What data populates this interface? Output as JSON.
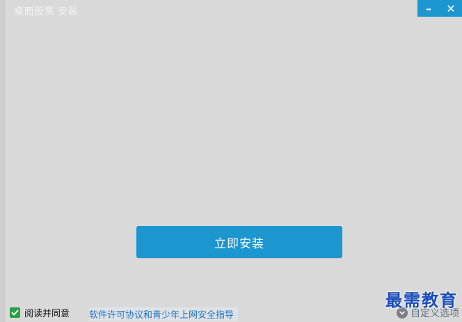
{
  "window": {
    "title": "桌面股票 安装",
    "minimize_glyph": "–",
    "close_glyph": "✕"
  },
  "main": {
    "install_label": "立即安装"
  },
  "footer": {
    "agree_checked": true,
    "agree_label": "阅读并同意",
    "license_link": "软件许可协议和青少年上网安全指导",
    "custom_options_label": "自定义选项"
  },
  "watermark": {
    "text": "最需教育"
  },
  "colors": {
    "background": "#d9d9d9",
    "accent": "#1b96cf",
    "checkbox": "#2aa043",
    "link": "#1e73be",
    "watermark": "#1a4bb8"
  },
  "icons": {
    "minimize": "minimize-icon",
    "close": "close-icon",
    "checkbox": "checkmark-icon",
    "custom_options": "chevron-down-circle-icon"
  }
}
